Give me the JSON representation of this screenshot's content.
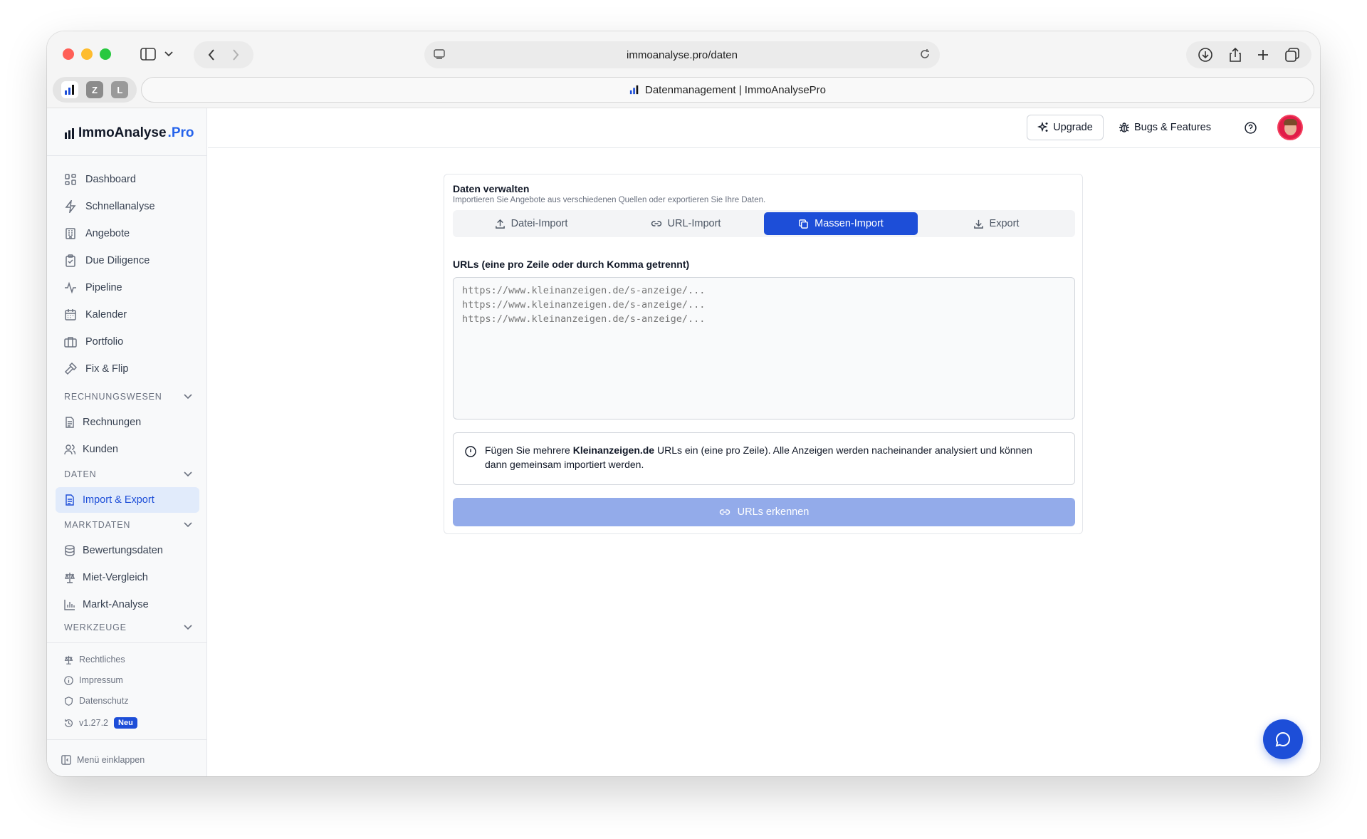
{
  "browser": {
    "url": "immoanalyse.pro/daten",
    "tab_title": "Datenmanagement | ImmoAnalysePro",
    "pinned_tabs": [
      "Z",
      "L"
    ]
  },
  "brand": {
    "name": "ImmoAnalyse",
    "suffix": ".Pro"
  },
  "sidebar": {
    "main_items": [
      {
        "label": "Dashboard",
        "icon": "grid-icon"
      },
      {
        "label": "Schnellanalyse",
        "icon": "lightning-icon"
      },
      {
        "label": "Angebote",
        "icon": "building-icon"
      },
      {
        "label": "Due Diligence",
        "icon": "clipboard-check-icon"
      },
      {
        "label": "Pipeline",
        "icon": "activity-icon"
      },
      {
        "label": "Kalender",
        "icon": "calendar-icon"
      },
      {
        "label": "Portfolio",
        "icon": "briefcase-icon"
      },
      {
        "label": "Fix & Flip",
        "icon": "hammer-icon"
      }
    ],
    "sections": {
      "rechnungswesen": {
        "title": "RECHNUNGSWESEN",
        "items": [
          "Rechnungen",
          "Kunden"
        ]
      },
      "daten": {
        "title": "DATEN",
        "items": [
          "Import & Export"
        ]
      },
      "marktdaten": {
        "title": "MARKTDATEN",
        "items": [
          "Bewertungsdaten",
          "Miet-Vergleich",
          "Markt-Analyse"
        ]
      },
      "werkzeuge": {
        "title": "WERKZEUGE"
      }
    },
    "footer": {
      "legal": "Rechtliches",
      "impressum": "Impressum",
      "datenschutz": "Datenschutz",
      "version": "v1.27.2",
      "version_badge": "Neu",
      "collapse": "Menü einklappen"
    }
  },
  "topbar": {
    "upgrade": "Upgrade",
    "bugs": "Bugs & Features"
  },
  "card": {
    "title": "Daten verwalten",
    "subtitle": "Importieren Sie Angebote aus verschiedenen Quellen oder exportieren Sie Ihre Daten.",
    "tabs": [
      "Datei-Import",
      "URL-Import",
      "Massen-Import",
      "Export"
    ],
    "active_tab": "Massen-Import",
    "field_label": "URLs (eine pro Zeile oder durch Komma getrennt)",
    "placeholder": "https://www.kleinanzeigen.de/s-anzeige/...\nhttps://www.kleinanzeigen.de/s-anzeige/...\nhttps://www.kleinanzeigen.de/s-anzeige/...",
    "info_before": "Fügen Sie mehrere ",
    "info_bold": "Kleinanzeigen.de",
    "info_after": " URLs ein (eine pro Zeile). Alle Anzeigen werden nacheinander analysiert und können dann gemeinsam importiert werden.",
    "submit": "URLs erkennen"
  },
  "colors": {
    "accent": "#1d4ed8",
    "accent_disabled": "#93abea",
    "active_bg": "#e1ebfb"
  }
}
